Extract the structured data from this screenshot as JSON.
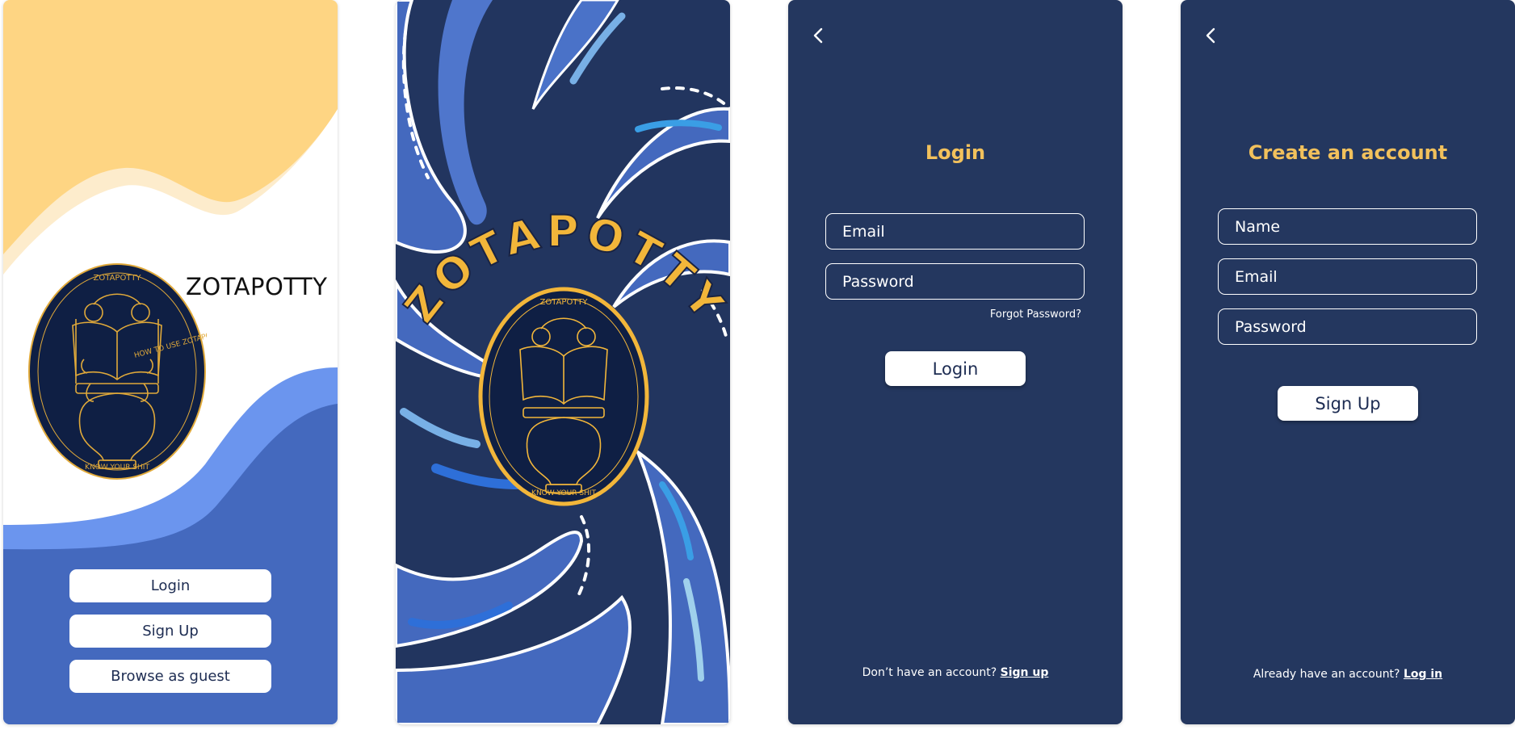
{
  "welcome": {
    "brand_title": "ZOTAPOTTY",
    "emblem_text_top": "ZOTAPOTTY",
    "emblem_text_bottom": "KNOW YOUR SHIT",
    "emblem_book_text": "HOW TO USE ZOTAPOTTY",
    "buttons": {
      "login": "Login",
      "signup": "Sign Up",
      "guest": "Browse as guest"
    }
  },
  "splash": {
    "brand_arc": "ZOTAPOTTY",
    "emblem_text_top": "ZOTAPOTTY",
    "emblem_text_bottom": "KNOW YOUR SHIT"
  },
  "login": {
    "title": "Login",
    "email_placeholder": "Email",
    "password_placeholder": "Password",
    "forgot": "Forgot Password?",
    "submit": "Login",
    "footer_prompt": "Don’t have an account?",
    "footer_link": "Sign up"
  },
  "signup": {
    "title": "Create an account",
    "name_placeholder": "Name",
    "email_placeholder": "Email",
    "password_placeholder": "Password",
    "submit": "Sign Up",
    "footer_prompt": "Already have an account?",
    "footer_link": "Log in"
  },
  "icons": {
    "back": "chevron-left-icon"
  },
  "colors": {
    "navy": "#24375f",
    "gold": "#f2c15c",
    "royal_blue": "#4469be",
    "light_blue": "#6b95ee",
    "sand": "#fed583",
    "emblem_fill": "#0f1f44"
  }
}
